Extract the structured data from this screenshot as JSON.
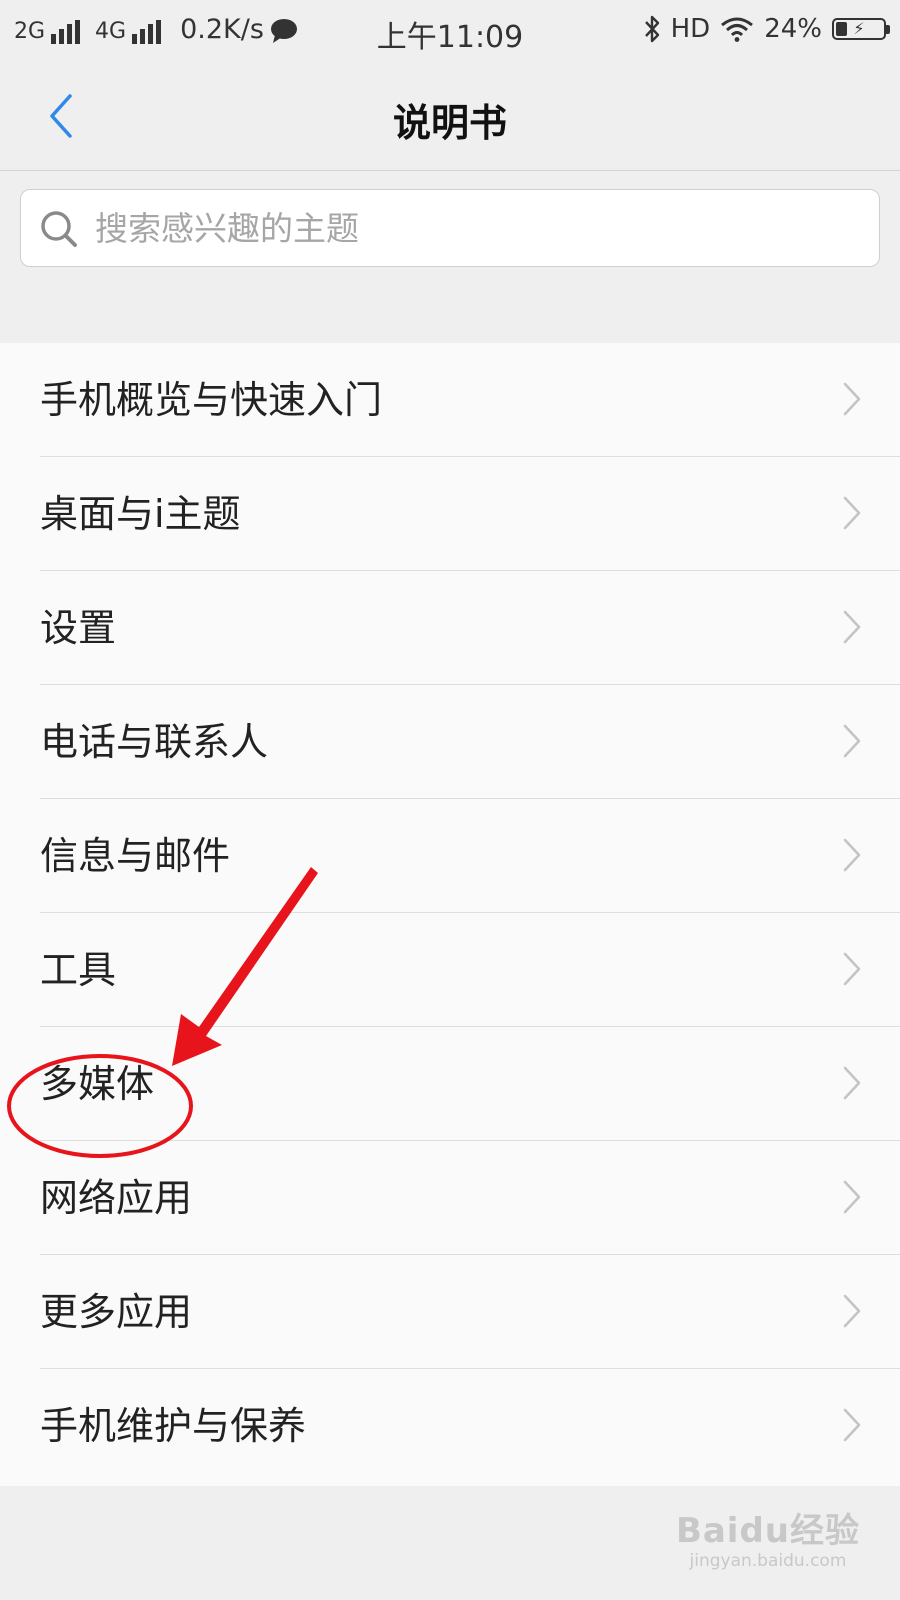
{
  "status_bar": {
    "net1": "2G",
    "net2": "4G",
    "speed": "0.2K/s",
    "time": "上午11:09",
    "hd": "HD",
    "battery": "24%",
    "battery_level": 0.24
  },
  "header": {
    "title": "说明书"
  },
  "search": {
    "placeholder": "搜索感兴趣的主题"
  },
  "menu": {
    "items": [
      {
        "label": "手机概览与快速入门"
      },
      {
        "label": "桌面与i主题"
      },
      {
        "label": "设置"
      },
      {
        "label": "电话与联系人"
      },
      {
        "label": "信息与邮件"
      },
      {
        "label": "工具"
      },
      {
        "label": "多媒体"
      },
      {
        "label": "网络应用"
      },
      {
        "label": "更多应用"
      },
      {
        "label": "手机维护与保养"
      }
    ]
  },
  "watermark": {
    "logo": "Baidu经验",
    "url": "jingyan.baidu.com"
  },
  "colors": {
    "accent": "#2d8ae8",
    "annotation": "#e8141c"
  }
}
